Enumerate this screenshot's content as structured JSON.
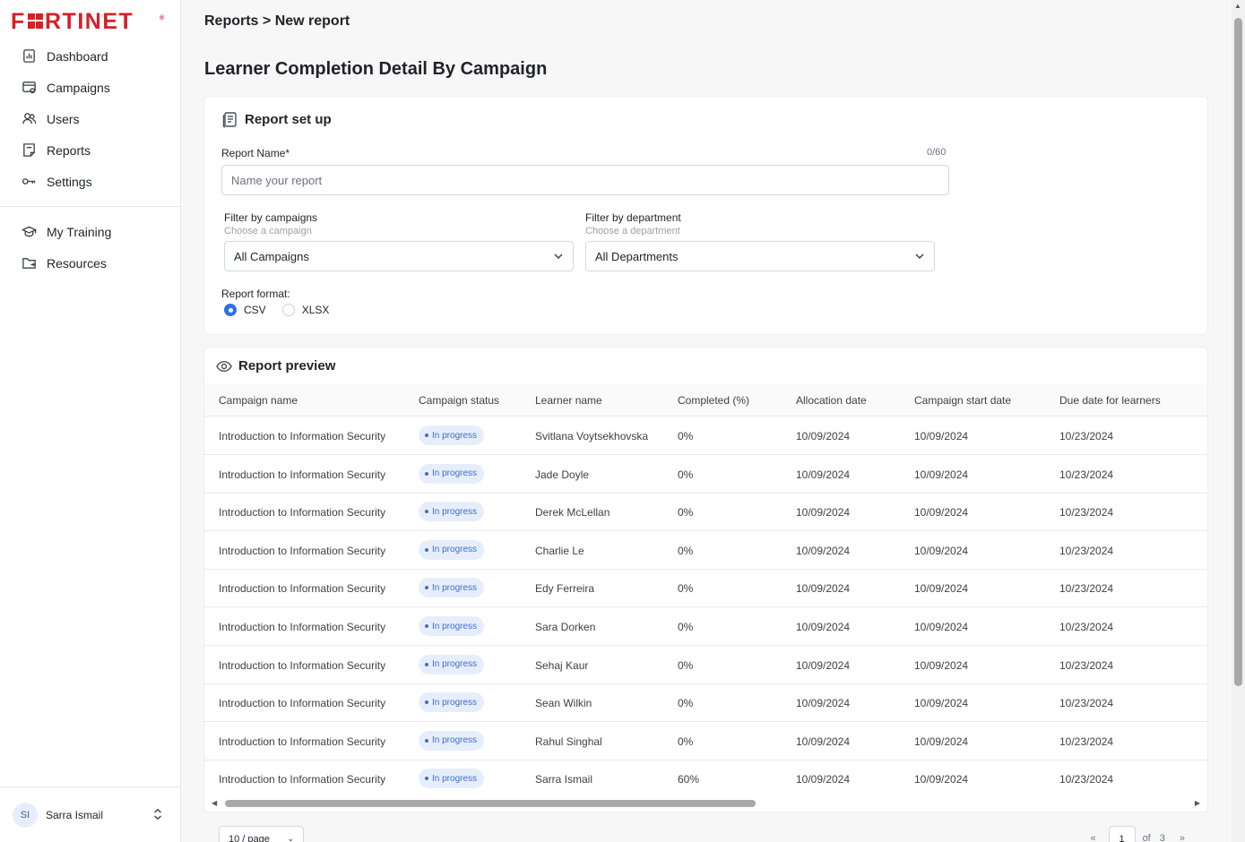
{
  "brand": {
    "logo_text": "F■RTINET",
    "logo_mark": "®"
  },
  "sidebar": {
    "items": [
      {
        "label": "Dashboard",
        "icon": "dashboard-icon"
      },
      {
        "label": "Campaigns",
        "icon": "campaigns-icon"
      },
      {
        "label": "Users",
        "icon": "users-icon"
      },
      {
        "label": "Reports",
        "icon": "reports-icon"
      },
      {
        "label": "Settings",
        "icon": "settings-icon"
      }
    ],
    "secondary": [
      {
        "label": "My Training",
        "icon": "graduation-cap-icon"
      },
      {
        "label": "Resources",
        "icon": "folder-icon"
      }
    ],
    "user": {
      "initials": "SI",
      "name": "Sarra Ismail"
    }
  },
  "header": {
    "breadcrumb": "Reports > New report",
    "title": "Learner Completion Detail By Campaign"
  },
  "setup": {
    "title": "Report set up",
    "name_label": "Report Name*",
    "name_counter": "0/60",
    "name_placeholder": "Name your report",
    "campaign_label": "Filter by campaigns",
    "campaign_hint": "Choose a campaign",
    "campaign_value": "All Campaigns",
    "department_label": "Filter by department",
    "department_hint": "Choose a department",
    "department_value": "All Departments",
    "format_label": "Report format:",
    "formats": [
      "CSV",
      "XLSX"
    ],
    "selected_format": "CSV"
  },
  "preview": {
    "title": "Report preview",
    "columns": [
      "Campaign name",
      "Campaign status",
      "Learner name",
      "Completed (%)",
      "Allocation date",
      "Campaign start date",
      "Due date for learners"
    ],
    "rows": [
      [
        "Introduction to Information Security",
        "In progress",
        "Svitlana Voytsekhovska",
        "0%",
        "10/09/2024",
        "10/09/2024",
        "10/23/2024"
      ],
      [
        "Introduction to Information Security",
        "In progress",
        "Jade Doyle",
        "0%",
        "10/09/2024",
        "10/09/2024",
        "10/23/2024"
      ],
      [
        "Introduction to Information Security",
        "In progress",
        "Derek McLellan",
        "0%",
        "10/09/2024",
        "10/09/2024",
        "10/23/2024"
      ],
      [
        "Introduction to Information Security",
        "In progress",
        "Charlie Le",
        "0%",
        "10/09/2024",
        "10/09/2024",
        "10/23/2024"
      ],
      [
        "Introduction to Information Security",
        "In progress",
        "Edy Ferreira",
        "0%",
        "10/09/2024",
        "10/09/2024",
        "10/23/2024"
      ],
      [
        "Introduction to Information Security",
        "In progress",
        "Sara Dorken",
        "0%",
        "10/09/2024",
        "10/09/2024",
        "10/23/2024"
      ],
      [
        "Introduction to Information Security",
        "In progress",
        "Sehaj Kaur",
        "0%",
        "10/09/2024",
        "10/09/2024",
        "10/23/2024"
      ],
      [
        "Introduction to Information Security",
        "In progress",
        "Sean Wilkin",
        "0%",
        "10/09/2024",
        "10/09/2024",
        "10/23/2024"
      ],
      [
        "Introduction to Information Security",
        "In progress",
        "Rahul Singhal",
        "0%",
        "10/09/2024",
        "10/09/2024",
        "10/23/2024"
      ],
      [
        "Introduction to Information Security",
        "In progress",
        "Sarra Ismail",
        "60%",
        "10/09/2024",
        "10/09/2024",
        "10/23/2024"
      ]
    ]
  },
  "pagination": {
    "page_size": "10 / page",
    "current_page": "1",
    "of_label": "of",
    "total_pages": "3"
  },
  "colors": {
    "brand": "#d81f26",
    "accent": "#2f6fe6",
    "badge_bg": "#e7eefb",
    "badge_text": "#3a6fd0"
  }
}
